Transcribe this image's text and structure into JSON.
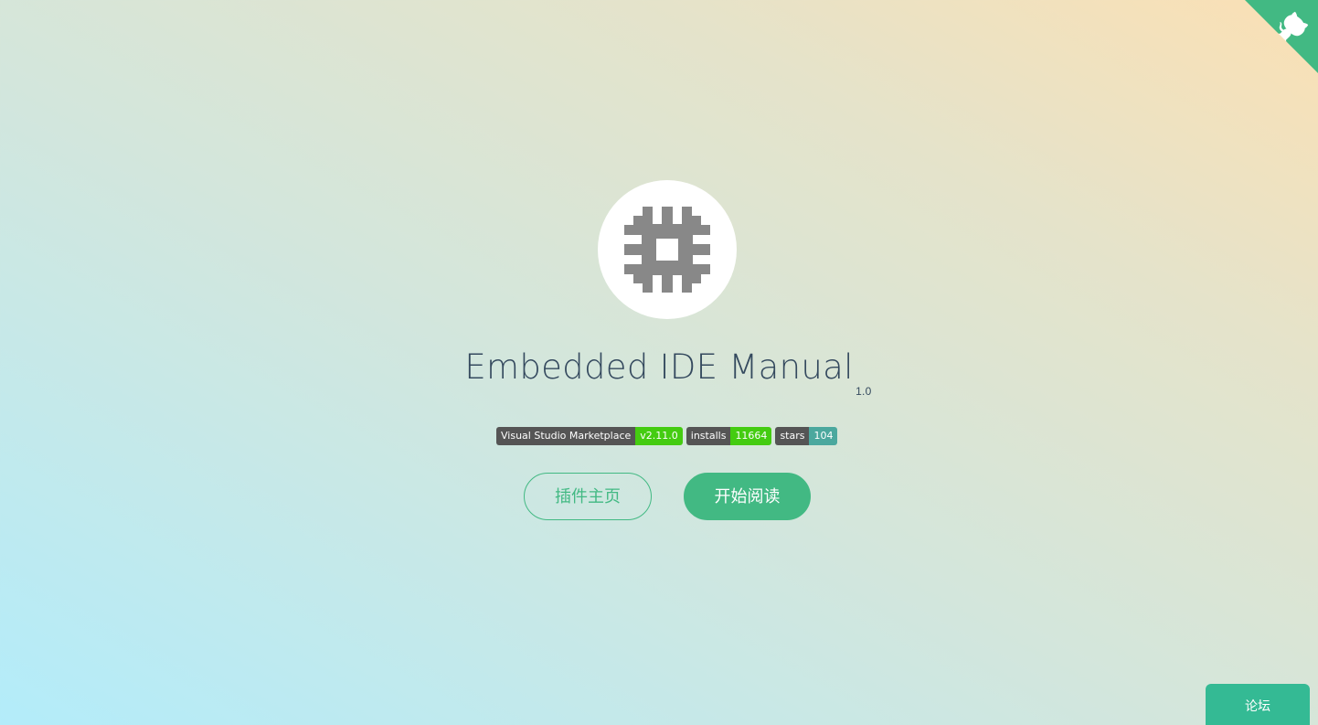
{
  "github_corner": {
    "icon": "github-octocat-icon",
    "accent_color": "#42b983"
  },
  "cover": {
    "logo_icon": "chip-icon",
    "title": "Embedded IDE Manual",
    "version": "1.0",
    "badges": [
      {
        "label": "Visual Studio Marketplace",
        "value": "v2.11.0",
        "color": "#4c1"
      },
      {
        "label": "installs",
        "value": "11664",
        "color": "#4c1"
      },
      {
        "label": "stars",
        "value": "104",
        "color": "#4ba89e"
      }
    ],
    "buttons": {
      "plugin_home": "插件主页",
      "start_reading": "开始阅读"
    }
  },
  "forum": {
    "label": "论坛",
    "color": "#34ba94"
  }
}
